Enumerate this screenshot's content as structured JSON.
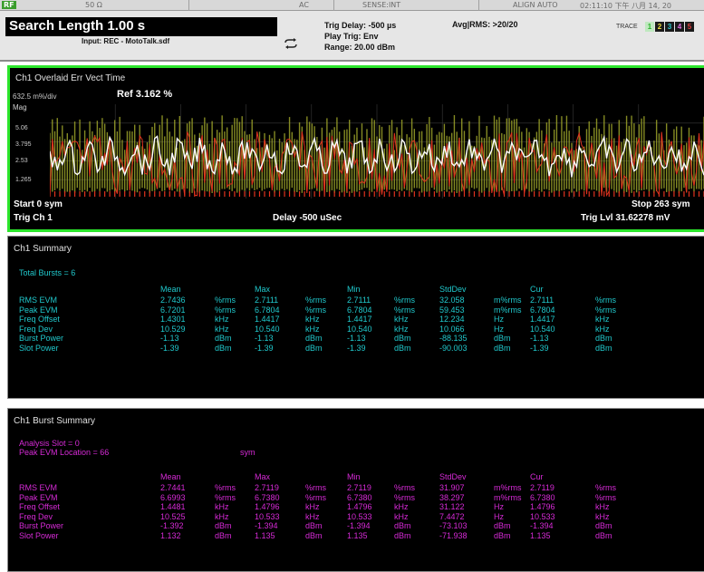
{
  "status_bar": {
    "rf_label": "RF",
    "field1": "50 Ω",
    "field2": "AC",
    "field3": "SENSE:INT",
    "align": "ALIGN AUTO",
    "datetime": "02:11:10 下午 八月 14, 20"
  },
  "header": {
    "title": "Search Length  1.00 s",
    "input": "Input: REC - MotoTalk.sdf",
    "trig_delay": "Trig Delay: -500 µs",
    "play_trig": "Play Trig: Env",
    "range": "Range: 20.00 dBm",
    "avg_rms": "Avg|RMS: >20/20",
    "trace_label": "TRACE",
    "trace_numbers": [
      "1",
      "2",
      "3",
      "4",
      "5"
    ],
    "trace_colors": [
      "#2bb02b",
      "#f0e040",
      "#30c8d0",
      "#e070e0",
      "#e04040"
    ]
  },
  "graph": {
    "title": "Ch1 Overlaid Err Vect Time",
    "scale": "632.5 m%/div",
    "ref": "Ref 3.162  %",
    "mag_label": "Mag",
    "y_ticks": [
      "5.06",
      "3.795",
      "2.53",
      "1.265"
    ],
    "start": "Start 0  sym",
    "stop": "Stop 263  sym",
    "trig_ch": "Trig Ch 1",
    "delay": "Delay -500 uSec",
    "trig_lvl": "Trig Lvl 31.62278 mV",
    "colors": {
      "border": "#2ce62c",
      "white_trace": "#ffffff",
      "yellow_trace": "#9ca32a",
      "red_trace": "#e0321e",
      "grid": "#7a7a2a"
    }
  },
  "summary": {
    "title": "Ch1 Summary",
    "total_bursts": "Total Bursts =  6",
    "columns": [
      "Mean",
      "Max",
      "Min",
      "StdDev",
      "Cur"
    ],
    "rows": [
      {
        "name": "RMS EVM",
        "values": [
          "2.7436",
          "%rms",
          "2.7111",
          "%rms",
          "2.7111",
          "%rms",
          "32.058",
          "m%rms",
          "2.7111",
          "%rms"
        ]
      },
      {
        "name": "Peak  EVM",
        "values": [
          "6.7201",
          "%rms",
          "6.7804",
          "%rms",
          "6.7804",
          "%rms",
          "59.453",
          "m%rms",
          "6.7804",
          "%rms"
        ]
      },
      {
        "name": "Freq  Offset",
        "values": [
          "1.4301",
          "kHz",
          "1.4417",
          "kHz",
          "1.4417",
          "kHz",
          "12.234",
          "Hz",
          "1.4417",
          "kHz"
        ]
      },
      {
        "name": "Freq  Dev",
        "values": [
          "10.529",
          "kHz",
          "10.540",
          "kHz",
          "10.540",
          "kHz",
          "10.066",
          "Hz",
          "10.540",
          "kHz"
        ]
      },
      {
        "name": "Burst   Power",
        "values": [
          "-1.13",
          "dBm",
          "-1.13",
          "dBm",
          "-1.13",
          "dBm",
          "-88.135",
          "dBm",
          "-1.13",
          "dBm"
        ]
      },
      {
        "name": "Slot   Power",
        "values": [
          "-1.39",
          "dBm",
          "-1.39",
          "dBm",
          "-1.39",
          "dBm",
          "-90.003",
          "dBm",
          "-1.39",
          "dBm"
        ]
      }
    ]
  },
  "burst_summary": {
    "title": "Ch1 Burst Summary",
    "analysis_slot": "Analysis Slot          =  0",
    "peak_evm_location": "Peak EVM Location =  66",
    "sym_label": "sym",
    "columns": [
      "Mean",
      "Max",
      "Min",
      "StdDev",
      "Cur"
    ],
    "rows": [
      {
        "name": "RMS EVM",
        "values": [
          "2.7441",
          "%rms",
          "2.7119",
          "%rms",
          "2.7119",
          "%rms",
          "31.907",
          "m%rms",
          "2.7119",
          "%rms"
        ]
      },
      {
        "name": "Peak  EVM",
        "values": [
          "6.6993",
          "%rms",
          "6.7380",
          "%rms",
          "6.7380",
          "%rms",
          "38.297",
          "m%rms",
          "6.7380",
          "%rms"
        ]
      },
      {
        "name": "Freq  Offset",
        "values": [
          "1.4481",
          "kHz",
          "1.4796",
          "kHz",
          "1.4796",
          "kHz",
          "31.122",
          "Hz",
          "1.4796",
          "kHz"
        ]
      },
      {
        "name": "Freq  Dev",
        "values": [
          "10.525",
          "kHz",
          "10.533",
          "kHz",
          "10.533",
          "kHz",
          "7.4472",
          "Hz",
          "10.533",
          "kHz"
        ]
      },
      {
        "name": "Burst   Power",
        "values": [
          "-1.392",
          "dBm",
          "-1.394",
          "dBm",
          "-1.394",
          "dBm",
          "-73.103",
          "dBm",
          "-1.394",
          "dBm"
        ]
      },
      {
        "name": "Slot   Power",
        "values": [
          "1.132",
          "dBm",
          "1.135",
          "dBm",
          "1.135",
          "dBm",
          "-71.938",
          "dBm",
          "1.135",
          "dBm"
        ]
      }
    ]
  }
}
